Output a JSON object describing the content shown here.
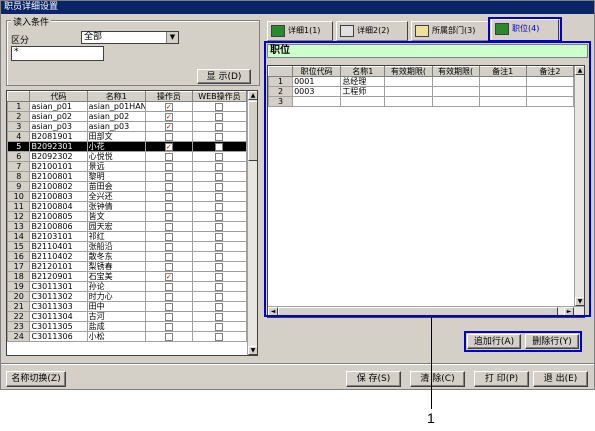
{
  "window": {
    "title": "职员详细设置"
  },
  "filter": {
    "legend": "读入条件",
    "category_label": "区分",
    "category_value": "全部",
    "search_value": "*",
    "display_button": "显  示(D)"
  },
  "left_grid": {
    "headers": [
      "代码",
      "名称1",
      "操作员",
      "WEB操作员"
    ],
    "rows": [
      {
        "n": "1",
        "code": "asian_p01",
        "name": "asian_p01HAN",
        "op": true,
        "web": false
      },
      {
        "n": "2",
        "code": "asian_p02",
        "name": "asian_p02",
        "op": true,
        "web": false
      },
      {
        "n": "3",
        "code": "asian_p03",
        "name": "asian_p03",
        "op": true,
        "web": false
      },
      {
        "n": "4",
        "code": "B2081901",
        "name": "田部文",
        "op": false,
        "web": false
      },
      {
        "n": "5",
        "code": "B2092301",
        "name": "小花",
        "op": true,
        "web": false
      },
      {
        "n": "6",
        "code": "B2092302",
        "name": "心悦悦",
        "op": false,
        "web": false
      },
      {
        "n": "7",
        "code": "B2100101",
        "name": "景远",
        "op": false,
        "web": false
      },
      {
        "n": "8",
        "code": "B2100801",
        "name": "黎明",
        "op": false,
        "web": false
      },
      {
        "n": "9",
        "code": "B2100802",
        "name": "苗田会",
        "op": false,
        "web": false
      },
      {
        "n": "10",
        "code": "B2100803",
        "name": "全兴还",
        "op": false,
        "web": false
      },
      {
        "n": "11",
        "code": "B2100804",
        "name": "张钟倩",
        "op": false,
        "web": false
      },
      {
        "n": "12",
        "code": "B2100805",
        "name": "皆文",
        "op": false,
        "web": false
      },
      {
        "n": "13",
        "code": "B2100806",
        "name": "园天宏",
        "op": false,
        "web": false
      },
      {
        "n": "14",
        "code": "B2103101",
        "name": "祁红",
        "op": false,
        "web": false
      },
      {
        "n": "15",
        "code": "B2110401",
        "name": "张船沿",
        "op": false,
        "web": false
      },
      {
        "n": "16",
        "code": "B2110402",
        "name": "散冬东",
        "op": false,
        "web": false
      },
      {
        "n": "17",
        "code": "B2120101",
        "name": "梨锈春",
        "op": false,
        "web": false
      },
      {
        "n": "18",
        "code": "B2120901",
        "name": "石宝美",
        "op": true,
        "web": false
      },
      {
        "n": "19",
        "code": "C3011301",
        "name": "孙论",
        "op": false,
        "web": false
      },
      {
        "n": "20",
        "code": "C3011302",
        "name": "时力心",
        "op": false,
        "web": false
      },
      {
        "n": "21",
        "code": "C3011303",
        "name": "田中",
        "op": false,
        "web": false
      },
      {
        "n": "22",
        "code": "C3011304",
        "name": "古河",
        "op": false,
        "web": false
      },
      {
        "n": "23",
        "code": "C3011305",
        "name": "盐成",
        "op": false,
        "web": false
      },
      {
        "n": "24",
        "code": "C3011306",
        "name": "小松",
        "op": false,
        "web": false
      }
    ],
    "selected_row": 5
  },
  "tabs": [
    {
      "label": "详细1(1)"
    },
    {
      "label": "详细2(2)"
    },
    {
      "label": "所属部门(3)"
    },
    {
      "label": "职位(4)"
    }
  ],
  "position_panel": {
    "title": "职位",
    "headers": [
      "职位代码",
      "名称1",
      "有效期限(",
      "有效期限(",
      "备注1",
      "备注2"
    ],
    "rows": [
      {
        "n": "1",
        "code": "0001",
        "name": "总经理"
      },
      {
        "n": "2",
        "code": "0003",
        "name": "工程师"
      },
      {
        "n": "3",
        "code": "",
        "name": ""
      }
    ],
    "add_row_button": "追加行(A)",
    "delete_row_button": "删除行(Y)"
  },
  "footer": {
    "name_switch_button": "名称切换(Z)",
    "save_button": "保 存(S)",
    "clear_button": "清 除(C)",
    "print_button": "打 印(P)",
    "exit_button": "退 出(E)"
  },
  "callout": {
    "number": "1",
    "color": "#0000cc"
  }
}
